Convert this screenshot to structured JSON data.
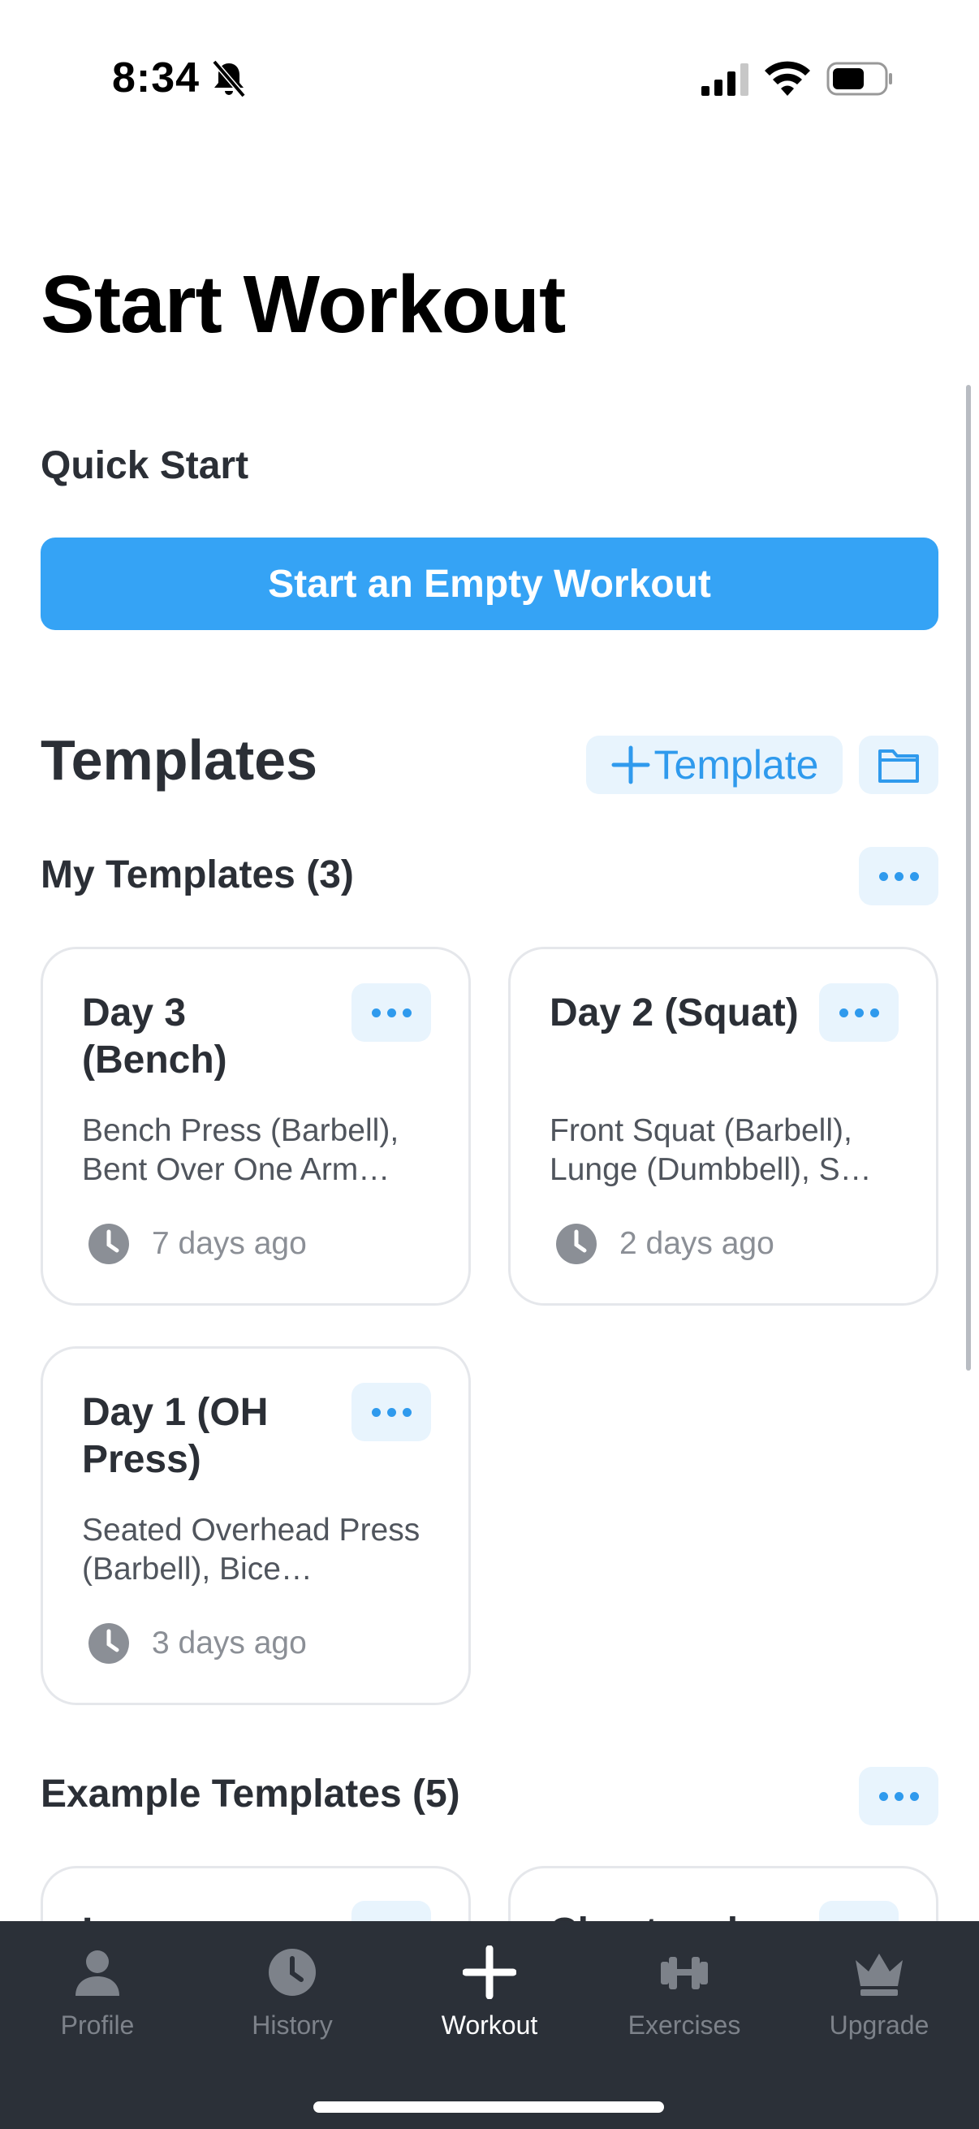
{
  "status_bar": {
    "time": "8:34"
  },
  "header": {
    "title": "Start Workout"
  },
  "quick_start": {
    "label": "Quick Start",
    "button_label": "Start an Empty Workout"
  },
  "templates": {
    "heading": "Templates",
    "add_button_label": "Template",
    "my_templates": {
      "heading": "My Templates (3)",
      "cards": [
        {
          "title": "Day 3 (Bench)",
          "description": "Bench Press (Barbell), Bent Over One Arm…",
          "last_used": "7 days ago"
        },
        {
          "title": "Day 2 (Squat)",
          "description": "Front Squat (Barbell), Lunge (Dumbbell), S…",
          "last_used": "2 days ago"
        },
        {
          "title": "Day 1 (OH Press)",
          "description": "Seated Overhead Press (Barbell), Bice…",
          "last_used": "3 days ago"
        }
      ]
    },
    "example_templates": {
      "heading": "Example Templates (5)",
      "cards": [
        {
          "title": "L"
        },
        {
          "title": "Chest and"
        }
      ]
    }
  },
  "tab_bar": {
    "tabs": [
      {
        "label": "Profile",
        "icon": "person-icon"
      },
      {
        "label": "History",
        "icon": "clock-icon"
      },
      {
        "label": "Workout",
        "icon": "plus-icon",
        "active": true
      },
      {
        "label": "Exercises",
        "icon": "dumbbell-icon"
      },
      {
        "label": "Upgrade",
        "icon": "crown-icon"
      }
    ]
  },
  "colors": {
    "accent": "#35a3f5",
    "accent_light": "#e8f4fd",
    "tab_bar_bg": "#2b3038"
  }
}
